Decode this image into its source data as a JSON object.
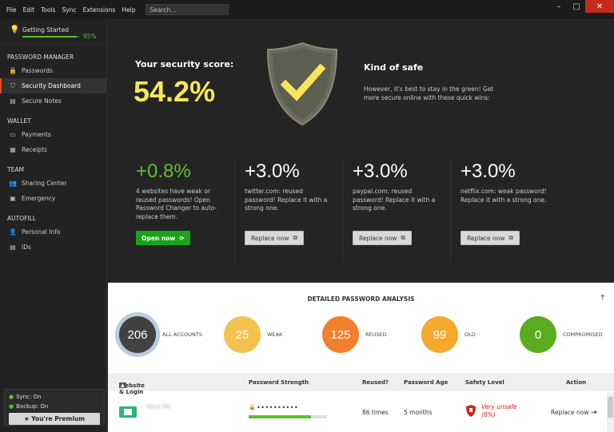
{
  "menu": [
    "File",
    "Edit",
    "Tools",
    "Sync",
    "Extensions",
    "Help"
  ],
  "search_placeholder": "Search...",
  "window_controls": {
    "minimize": "–",
    "maximize": "□",
    "close": "✕"
  },
  "sidebar": {
    "getting_started": {
      "label": "Getting Started",
      "progress": 95,
      "progress_text": "95%"
    },
    "sections": [
      {
        "title": "PASSWORD MANAGER",
        "items": [
          {
            "label": "Passwords",
            "icon": "lock-icon",
            "glyph": "🔒",
            "active": false
          },
          {
            "label": "Security Dashboard",
            "icon": "shield-icon",
            "glyph": "⛉",
            "active": true
          },
          {
            "label": "Secure Notes",
            "icon": "note-icon",
            "glyph": "▤",
            "active": false
          }
        ]
      },
      {
        "title": "WALLET",
        "items": [
          {
            "label": "Payments",
            "icon": "card-icon",
            "glyph": "▭",
            "active": false
          },
          {
            "label": "Receipts",
            "icon": "receipt-icon",
            "glyph": "▦",
            "active": false
          }
        ]
      },
      {
        "title": "TEAM",
        "items": [
          {
            "label": "Sharing Center",
            "icon": "people-icon",
            "glyph": "👥",
            "active": false
          },
          {
            "label": "Emergency",
            "icon": "emergency-icon",
            "glyph": "▣",
            "active": false
          }
        ]
      },
      {
        "title": "AUTOFILL",
        "items": [
          {
            "label": "Personal Info",
            "icon": "person-icon",
            "glyph": "👤",
            "active": false
          },
          {
            "label": "IDs",
            "icon": "id-card-icon",
            "glyph": "▤",
            "active": false
          }
        ]
      }
    ],
    "sync": "Sync: On",
    "backup": "Backup: On",
    "premium": "You're Premium"
  },
  "dashboard": {
    "score_label": "Your security score:",
    "score": "54.2%",
    "status_title": "Kind of safe",
    "status_desc": "However, it's best to stay in the green! Get more secure online with these quick wins:",
    "quick_wins": [
      {
        "gain": "+0.8%",
        "text": "4 websites have weak or reused passwords! Open Password Changer to auto-replace them.",
        "button": "Open now",
        "style": "green"
      },
      {
        "gain": "+3.0%",
        "text": "twitter.com: reused password! Replace it with a strong one.",
        "button": "Replace now",
        "style": "grey"
      },
      {
        "gain": "+3.0%",
        "text": "paypal.com: reused password! Replace it with a strong one.",
        "button": "Replace now",
        "style": "grey"
      },
      {
        "gain": "+3.0%",
        "text": "netflix.com: weak password! Replace it with a strong one.",
        "button": "Replace now",
        "style": "grey"
      }
    ]
  },
  "analysis": {
    "title": "DETAILED PASSWORD ANALYSIS",
    "stats": [
      {
        "value": "206",
        "label": "ALL ACCOUNTS",
        "color": "#414141"
      },
      {
        "value": "25",
        "label": "WEAK",
        "color": "#f2c14e"
      },
      {
        "value": "125",
        "label": "REUSED",
        "color": "#f47f2a"
      },
      {
        "value": "99",
        "label": "OLD",
        "color": "#f6a92a"
      },
      {
        "value": "0",
        "label": "COMPROMISED",
        "color": "#5aab1e"
      }
    ],
    "columns": [
      "Website & Login",
      "Password Strength",
      "Reused?",
      "Password Age",
      "Safety Level",
      "Action"
    ],
    "rows": [
      {
        "site": "Wed Mt",
        "password": "••••••••••",
        "strength": 0.8,
        "reused": "86 times",
        "age": "5 months",
        "safety": "Very unsafe",
        "safety_pct": "(8%)",
        "action": "Replace now"
      }
    ]
  }
}
